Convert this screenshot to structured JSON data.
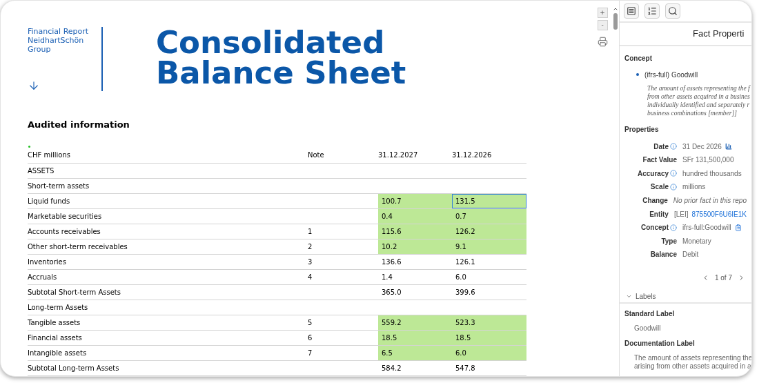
{
  "report": {
    "brand_lines": [
      "Financial Report",
      "NeidhartSchön",
      "Group"
    ],
    "title_lines": [
      "Consolidated",
      "Balance Sheet"
    ],
    "section": "Audited information"
  },
  "table": {
    "columns": [
      "CHF millions",
      "Note",
      "31.12.2027",
      "31.12.2026"
    ],
    "rows": [
      {
        "kind": "heading",
        "label": "ASSETS"
      },
      {
        "kind": "heading",
        "label": "Short-term assets"
      },
      {
        "kind": "data",
        "label": "Liquid funds",
        "values": [
          {
            "text": "100.7",
            "tagged": true,
            "selected": false
          },
          {
            "text": "131.5",
            "tagged": true,
            "selected": true
          }
        ]
      },
      {
        "kind": "data",
        "label": "Marketable securities",
        "values": [
          {
            "text": "0.4",
            "tagged": true,
            "selected": false
          },
          {
            "text": "0.7",
            "tagged": true,
            "selected": false
          }
        ]
      },
      {
        "kind": "data",
        "label": "Accounts receivables",
        "note": "1",
        "values": [
          {
            "text": "115.6",
            "tagged": true,
            "selected": false
          },
          {
            "text": "126.2",
            "tagged": true,
            "selected": false
          }
        ]
      },
      {
        "kind": "data",
        "label": "Other short-term receivables",
        "note": "2",
        "values": [
          {
            "text": "10.2",
            "tagged": true,
            "selected": false
          },
          {
            "text": "9.1",
            "tagged": true,
            "selected": false
          }
        ]
      },
      {
        "kind": "data",
        "label": "Inventories",
        "note": "3",
        "values": [
          {
            "text": "136.6",
            "tagged": false,
            "selected": false
          },
          {
            "text": "126.1",
            "tagged": false,
            "selected": false
          }
        ]
      },
      {
        "kind": "data",
        "label": "Accruals",
        "note": "4",
        "values": [
          {
            "text": "1.4",
            "tagged": false,
            "selected": false
          },
          {
            "text": "6.0",
            "tagged": false,
            "selected": false
          }
        ]
      },
      {
        "kind": "data",
        "label": "Subtotal Short-term Assets",
        "values": [
          {
            "text": "365.0",
            "tagged": false,
            "selected": false
          },
          {
            "text": "399.6",
            "tagged": false,
            "selected": false
          }
        ]
      },
      {
        "kind": "heading",
        "label": "Long-term Assets"
      },
      {
        "kind": "data",
        "label": "Tangible assets",
        "note": "5",
        "values": [
          {
            "text": "559.2",
            "tagged": true,
            "selected": false
          },
          {
            "text": "523.3",
            "tagged": true,
            "selected": false
          }
        ]
      },
      {
        "kind": "data",
        "label": "Financial assets",
        "note": "6",
        "values": [
          {
            "text": "18.5",
            "tagged": true,
            "selected": false
          },
          {
            "text": "18.5",
            "tagged": true,
            "selected": false
          }
        ]
      },
      {
        "kind": "data",
        "label": "Intangible assets",
        "note": "7",
        "values": [
          {
            "text": "6.5",
            "tagged": true,
            "selected": false
          },
          {
            "text": "6.0",
            "tagged": true,
            "selected": false
          }
        ]
      },
      {
        "kind": "data",
        "label": "Subtotal Long-term Assets",
        "values": [
          {
            "text": "584.2",
            "tagged": false,
            "selected": false
          },
          {
            "text": "547.8",
            "tagged": false,
            "selected": false
          }
        ]
      }
    ]
  },
  "zoom_controls": [
    "+",
    "-"
  ],
  "panel": {
    "title": "Fact Properti",
    "concept_heading": "Concept",
    "concept_name": "(ifrs-full) Goodwill",
    "concept_description": [
      "The amount of assets representing the f",
      "from other assets acquired in a busines",
      "individually identified and separately r",
      "business combinations [member]]"
    ],
    "properties_heading": "Properties",
    "properties": [
      {
        "kind": "date",
        "label": "Date",
        "info": true,
        "value": "31 Dec 2026"
      },
      {
        "kind": "plain",
        "label": "Fact Value",
        "info": false,
        "value": "SFr 131,500,000"
      },
      {
        "kind": "plain",
        "label": "Accuracy",
        "info": true,
        "value": "hundred thousands"
      },
      {
        "kind": "plain",
        "label": "Scale",
        "info": true,
        "value": "millions"
      },
      {
        "kind": "note",
        "label": "Change",
        "info": false,
        "value": "No prior fact in this repo"
      },
      {
        "kind": "entity",
        "label": "Entity",
        "info": false,
        "prefix": "[LEI]",
        "value": "875500F6U6IE1K"
      },
      {
        "kind": "concept",
        "label": "Concept",
        "info": true,
        "value": "ifrs-full:Goodwill"
      },
      {
        "kind": "plain",
        "label": "Type",
        "info": false,
        "value": "Monetary"
      },
      {
        "kind": "plain",
        "label": "Balance",
        "info": false,
        "value": "Debit"
      }
    ],
    "pager": "1 of 7",
    "labels_section": {
      "title": "Labels",
      "expanded": true,
      "items": [
        {
          "heading": "Standard Label",
          "lines": [
            "Goodwill"
          ]
        },
        {
          "heading": "Documentation Label",
          "lines": [
            "The amount of assets representing the",
            "arising from other assets acquired in a"
          ]
        }
      ]
    }
  }
}
